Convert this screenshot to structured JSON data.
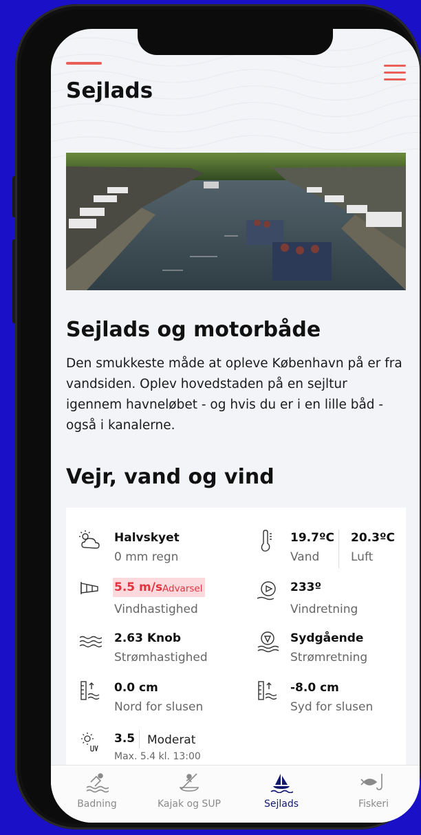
{
  "page": {
    "title": "Sejlads"
  },
  "hero_image": {
    "alt": ""
  },
  "article": {
    "heading": "Sejlads og motorbåde",
    "body": "Den smukkeste måde at opleve København på er fra vandsiden. Oplev hovedstaden på en sejltur igennem havneløbet - og hvis du er i en lille båd - også i kanalerne."
  },
  "weather": {
    "heading": "Vejr, vand og vind",
    "cloud": {
      "value": "Halvskyet",
      "sub": "0 mm regn"
    },
    "temperature": {
      "water_value": "19.7ºC",
      "water_label": "Vand",
      "air_value": "20.3ºC",
      "air_label": "Luft"
    },
    "wind_speed": {
      "value": "5.5 m/s",
      "warning": "Advarsel",
      "label": "Vindhastighed"
    },
    "wind_direction": {
      "value": "233º",
      "label": "Vindretning"
    },
    "current_speed": {
      "value": "2.63 Knob",
      "label": "Strømhastighed"
    },
    "current_direction": {
      "value": "Sydgående",
      "label": "Strømretning"
    },
    "level_north": {
      "value": "0.0 cm",
      "label": "Nord for slusen"
    },
    "level_south": {
      "value": "-8.0 cm",
      "label": "Syd for slusen"
    },
    "uv": {
      "value": "3.5",
      "level": "Moderat",
      "max": "Max. 5.4 kl. 13:00"
    }
  },
  "tabs": [
    {
      "label": "Badning",
      "icon": "swimmer-icon",
      "active": false
    },
    {
      "label": "Kajak og SUP",
      "icon": "kayak-icon",
      "active": false
    },
    {
      "label": "Sejlads",
      "icon": "sailboat-icon",
      "active": true
    },
    {
      "label": "Fiskeri",
      "icon": "fishing-icon",
      "active": false
    }
  ],
  "colors": {
    "accent": "#ea6058",
    "warning": "#e2323f",
    "active_tab": "#11196f",
    "background": "#1a10c8"
  }
}
